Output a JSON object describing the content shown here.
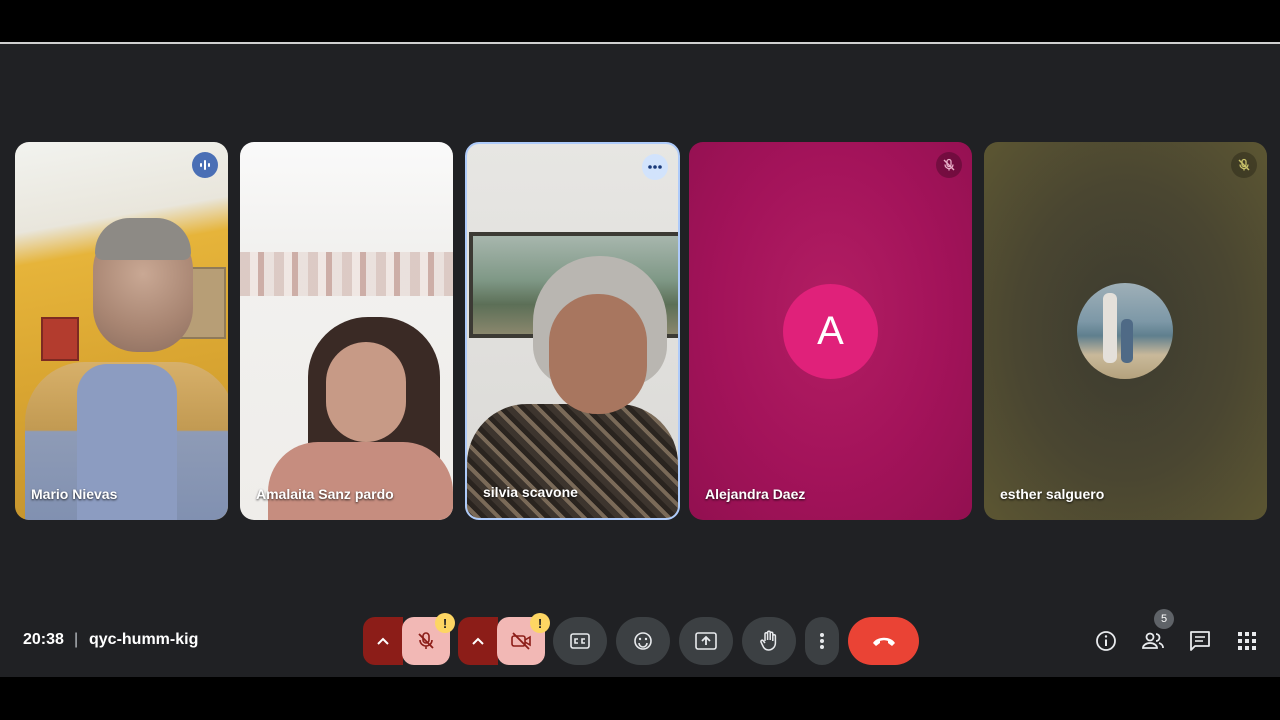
{
  "participants": [
    {
      "name": "Mario Nievas",
      "status": "speaking"
    },
    {
      "name": "Amalaita Sanz pardo",
      "status": ""
    },
    {
      "name": "silvia scavone",
      "status": "more-options"
    },
    {
      "name": "Alejandra Daez",
      "status": "muted",
      "avatar_letter": "A",
      "avatar_color": "#e0217a"
    },
    {
      "name": "esther salguero",
      "status": "muted"
    }
  ],
  "meeting": {
    "time": "20:38",
    "separator": "|",
    "code": "qyc-humm-kig"
  },
  "controls": {
    "mic_warning": "!",
    "camera_warning": "!",
    "items": [
      "chevron-up-icon",
      "mic-off-icon",
      "chevron-up-icon",
      "camera-off-icon",
      "captions-icon",
      "emoji-icon",
      "present-icon",
      "raise-hand-icon",
      "more-vert-icon",
      "end-call-icon"
    ]
  },
  "right_controls": {
    "participants_count": "5",
    "items": [
      "info-icon",
      "people-icon",
      "chat-icon",
      "activities-icon"
    ]
  },
  "colors": {
    "stage_bg": "#202124",
    "end_call": "#ea4335",
    "toggle_off": "#f2b8b5",
    "toggle_chevron": "#8c1d18",
    "active_border": "#aecbfa",
    "warning": "#fdd663"
  }
}
